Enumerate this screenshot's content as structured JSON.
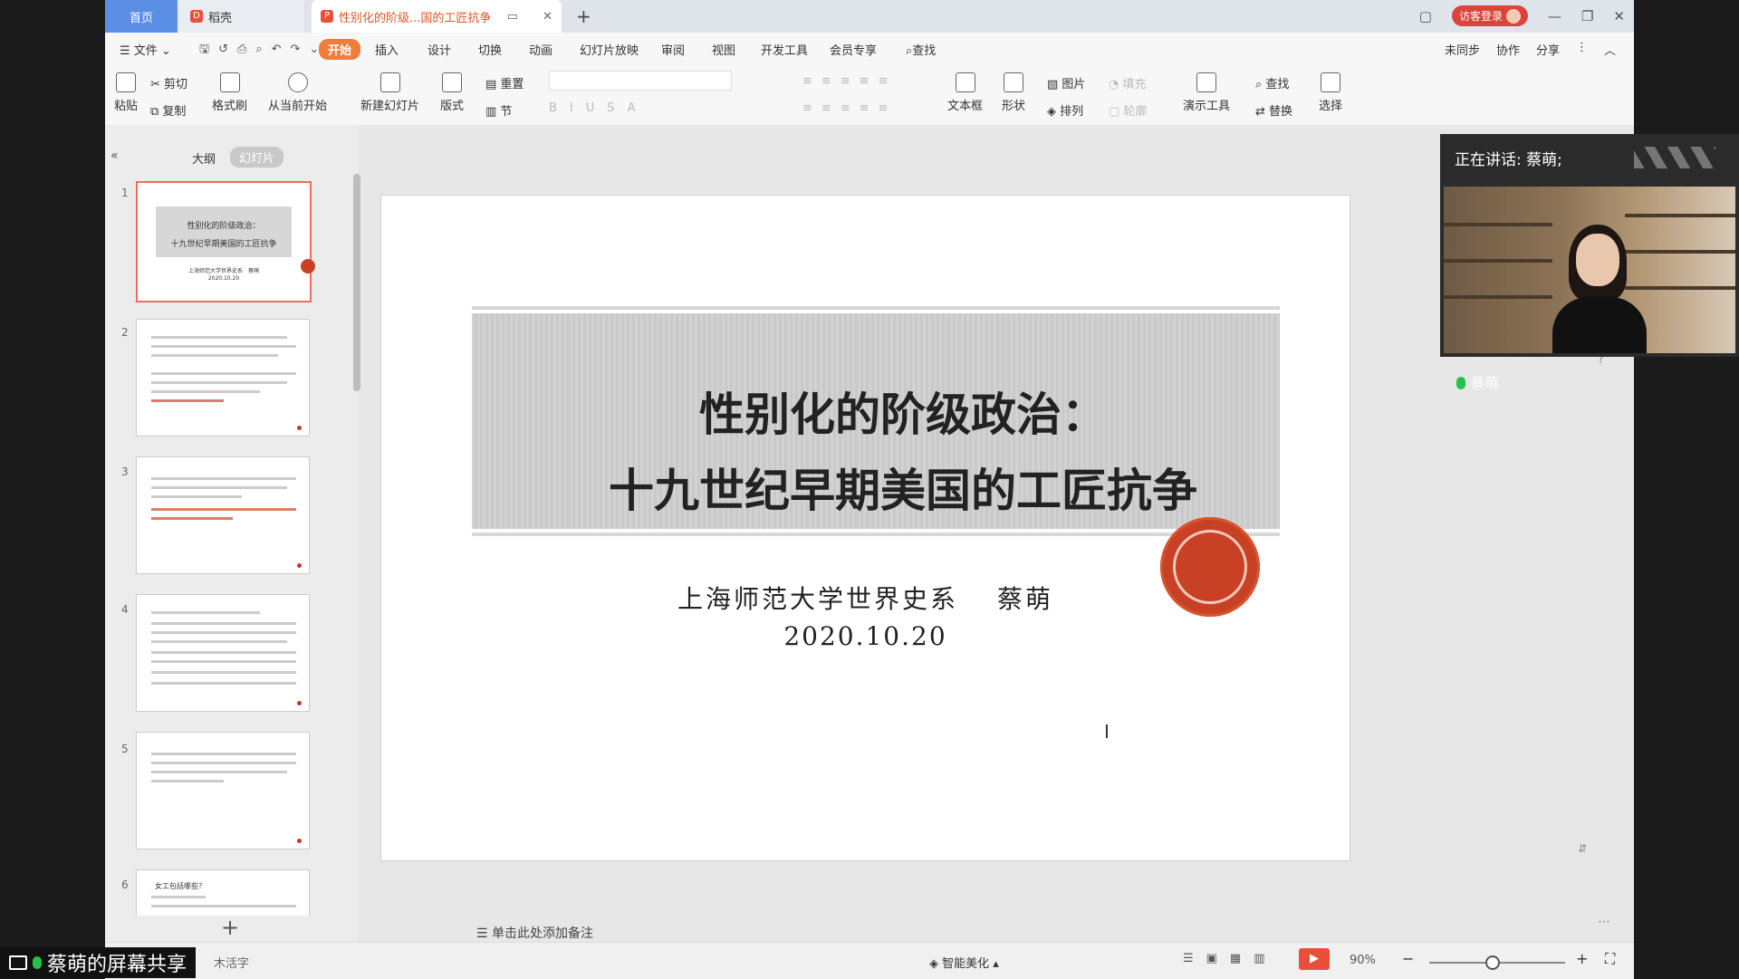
{
  "tabs": {
    "home": "首页",
    "daoke": "稻壳",
    "doc": "性别化的阶级...国的工匠抗争"
  },
  "window": {
    "visitor_login": "访客登录"
  },
  "menu": {
    "file": "文件",
    "items": [
      "开始",
      "插入",
      "设计",
      "切换",
      "动画",
      "幻灯片放映",
      "审阅",
      "视图",
      "开发工具",
      "会员专享"
    ],
    "search": "查找",
    "right": [
      "未同步",
      "协作",
      "分享"
    ]
  },
  "ribbon": {
    "paste": "粘贴",
    "cut": "剪切",
    "copy": "复制",
    "format_painter": "格式刷",
    "play_from_current": "从当前开始",
    "new_slide": "新建幻灯片",
    "layout": "版式",
    "reset": "重置",
    "section": "节",
    "textbox": "文本框",
    "shape": "形状",
    "picture": "图片",
    "arrange": "排列",
    "present_tool": "演示工具",
    "find": "查找",
    "replace": "替换",
    "select": "选择",
    "fill": "填充",
    "outline": "轮廓"
  },
  "panel": {
    "outline_tab": "大纲",
    "slides_tab": "幻灯片",
    "slide_numbers": [
      "1",
      "2",
      "3",
      "4",
      "5",
      "6"
    ],
    "thumb1_title1": "性别化的阶级政治：",
    "thumb1_title2": "十九世纪早期美国的工匠抗争",
    "thumb1_author": "上海师范大学世界史系　蔡萌",
    "thumb1_date": "2020.10.20",
    "thumb6_title": "女工包括哪些？"
  },
  "slide": {
    "title_line1": "性别化的阶级政治：",
    "title_line2": "十九世纪早期美国的工匠抗争",
    "author": "上海师范大学世界史系　 蔡萌",
    "date": "2020.10.20"
  },
  "video": {
    "speaking": "正在讲话: 蔡萌;",
    "name": "蔡萌"
  },
  "notes_placeholder": "单击此处添加备注",
  "status": {
    "share": "蔡萌的屏幕共享",
    "font_missing": "木活字",
    "beautify": "智能美化",
    "zoom": "90%"
  },
  "colors": {
    "accent": "#f07c3a",
    "seal": "#c94125",
    "tab_home": "#5b8fe6"
  }
}
